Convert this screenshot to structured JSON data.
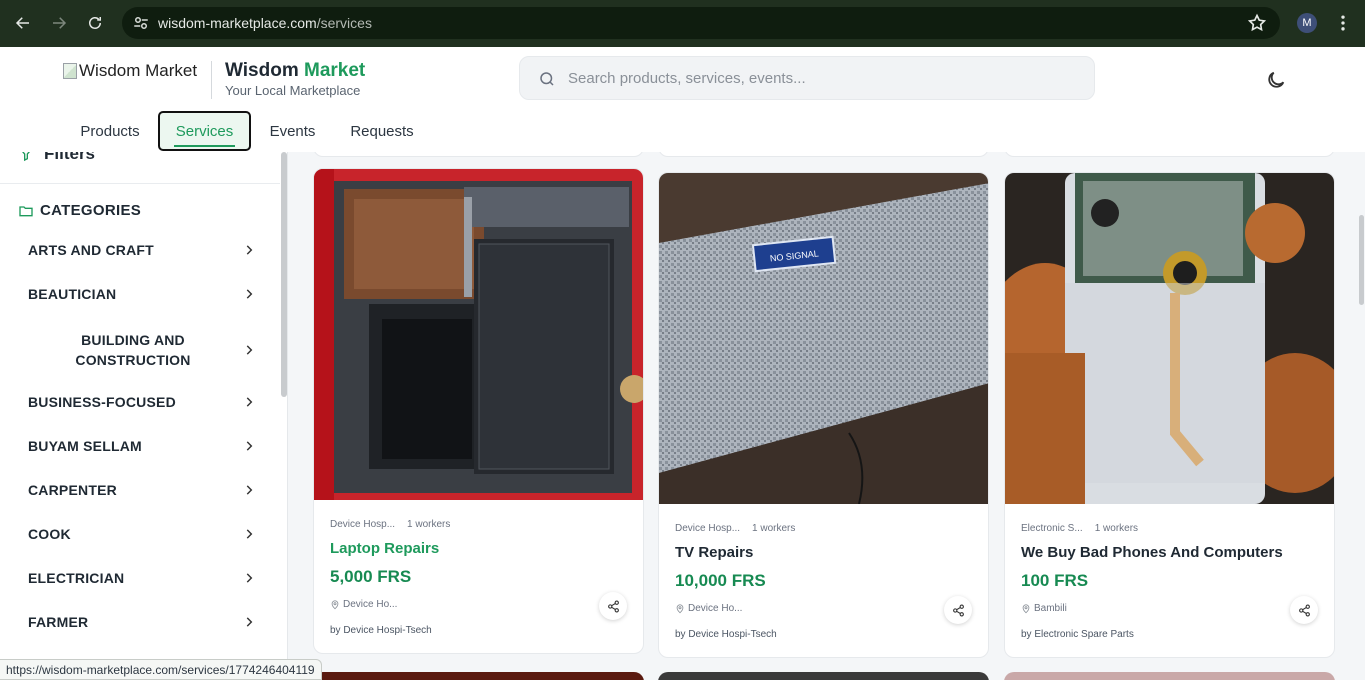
{
  "browser": {
    "url_host": "wisdom-marketplace.com",
    "url_path": "/services",
    "profile_initial": "M"
  },
  "header": {
    "logo_alt": "Wisdom Market",
    "brand_first": "Wisdom",
    "brand_second": "Market",
    "tagline": "Your Local Marketplace",
    "search_placeholder": "Search products, services, events..."
  },
  "tabs": [
    {
      "label": "Products"
    },
    {
      "label": "Services"
    },
    {
      "label": "Events"
    },
    {
      "label": "Requests"
    }
  ],
  "sidebar": {
    "filters_label": "Filters",
    "categories_label": "CATEGORIES",
    "categories": [
      {
        "label": "ARTS AND CRAFT"
      },
      {
        "label": "BEAUTICIAN"
      },
      {
        "label": "BUILDING AND CONSTRUCTION"
      },
      {
        "label": "BUSINESS-FOCUSED"
      },
      {
        "label": "BUYAM SELLAM"
      },
      {
        "label": "CARPENTER"
      },
      {
        "label": "COOK"
      },
      {
        "label": "ELECTRICIAN"
      },
      {
        "label": "FARMER"
      }
    ]
  },
  "listings": [
    {
      "category": "Device Hosp...",
      "workers": "1 workers",
      "title": "Laptop Repairs",
      "price": "5,000 FRS",
      "location": "Device Ho...",
      "by": "by Device Hospi-Tsech"
    },
    {
      "category": "Device Hosp...",
      "workers": "1 workers",
      "title": "TV Repairs",
      "price": "10,000 FRS",
      "location": "Device Ho...",
      "by": "by Device Hospi-Tsech"
    },
    {
      "category": "Electronic S...",
      "workers": "1 workers",
      "title": "We Buy Bad Phones And Computers",
      "price": "100 FRS",
      "location": "Bambili",
      "by": "by Electronic Spare Parts"
    }
  ],
  "image_labels": {
    "tv_screen": "NO SIGNAL"
  },
  "status_bar": {
    "hover_url": "https://wisdom-marketplace.com/services/1774246404119"
  },
  "colors": {
    "brand_green": "#1e9a5c",
    "chrome_bg": "#20301f"
  }
}
